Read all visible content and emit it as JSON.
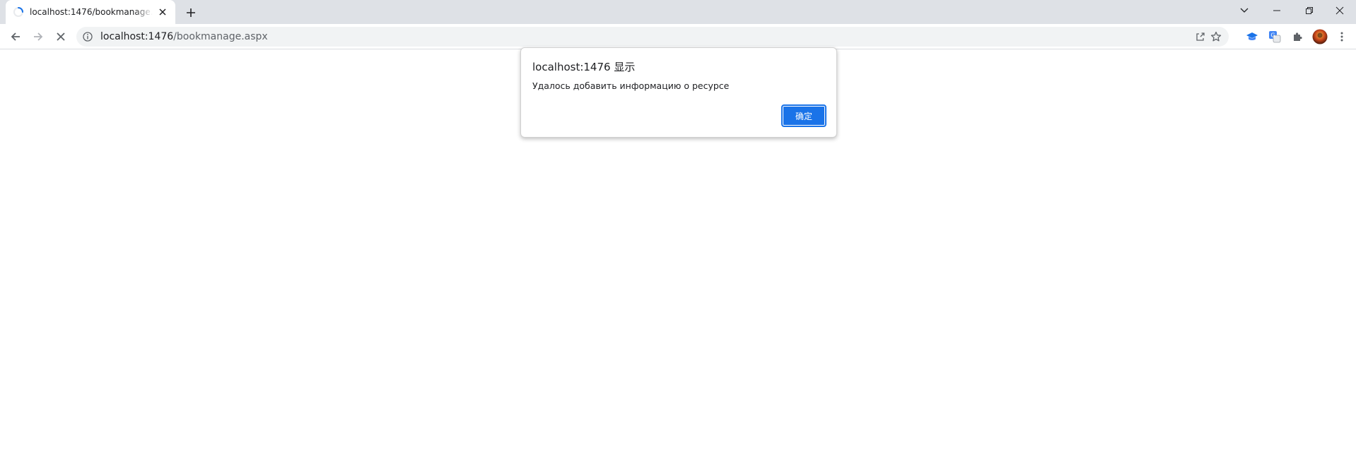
{
  "browser": {
    "tab": {
      "title": "localhost:1476/bookmanage.aspx",
      "status": "loading"
    },
    "address": {
      "host": "localhost:1476",
      "path": "/bookmanage.aspx"
    },
    "colors": {
      "accent": "#1a73e8",
      "tabstrip": "#dee1e6",
      "omnibox": "#f1f3f4"
    }
  },
  "dialog": {
    "title": "localhost:1476 显示",
    "message": "Удалось добавить информацию о ресурсе",
    "ok_label": "确定"
  },
  "icons": {
    "tab_loading": "spinner-icon",
    "tab_close": "close-icon",
    "new_tab": "plus-icon",
    "tab_search": "chevron-down-icon",
    "minimize": "minimize-icon",
    "restore": "restore-icon",
    "close_window": "close-icon",
    "back": "arrow-left-icon",
    "forward": "arrow-right-icon",
    "stop": "stop-loading-icon",
    "site_info": "info-icon",
    "share": "share-icon",
    "bookmark": "star-icon",
    "extensions": [
      "graduation-cap-icon",
      "translate-icon",
      "puzzle-icon"
    ],
    "profile": "avatar",
    "menu": "more-vertical-icon"
  }
}
